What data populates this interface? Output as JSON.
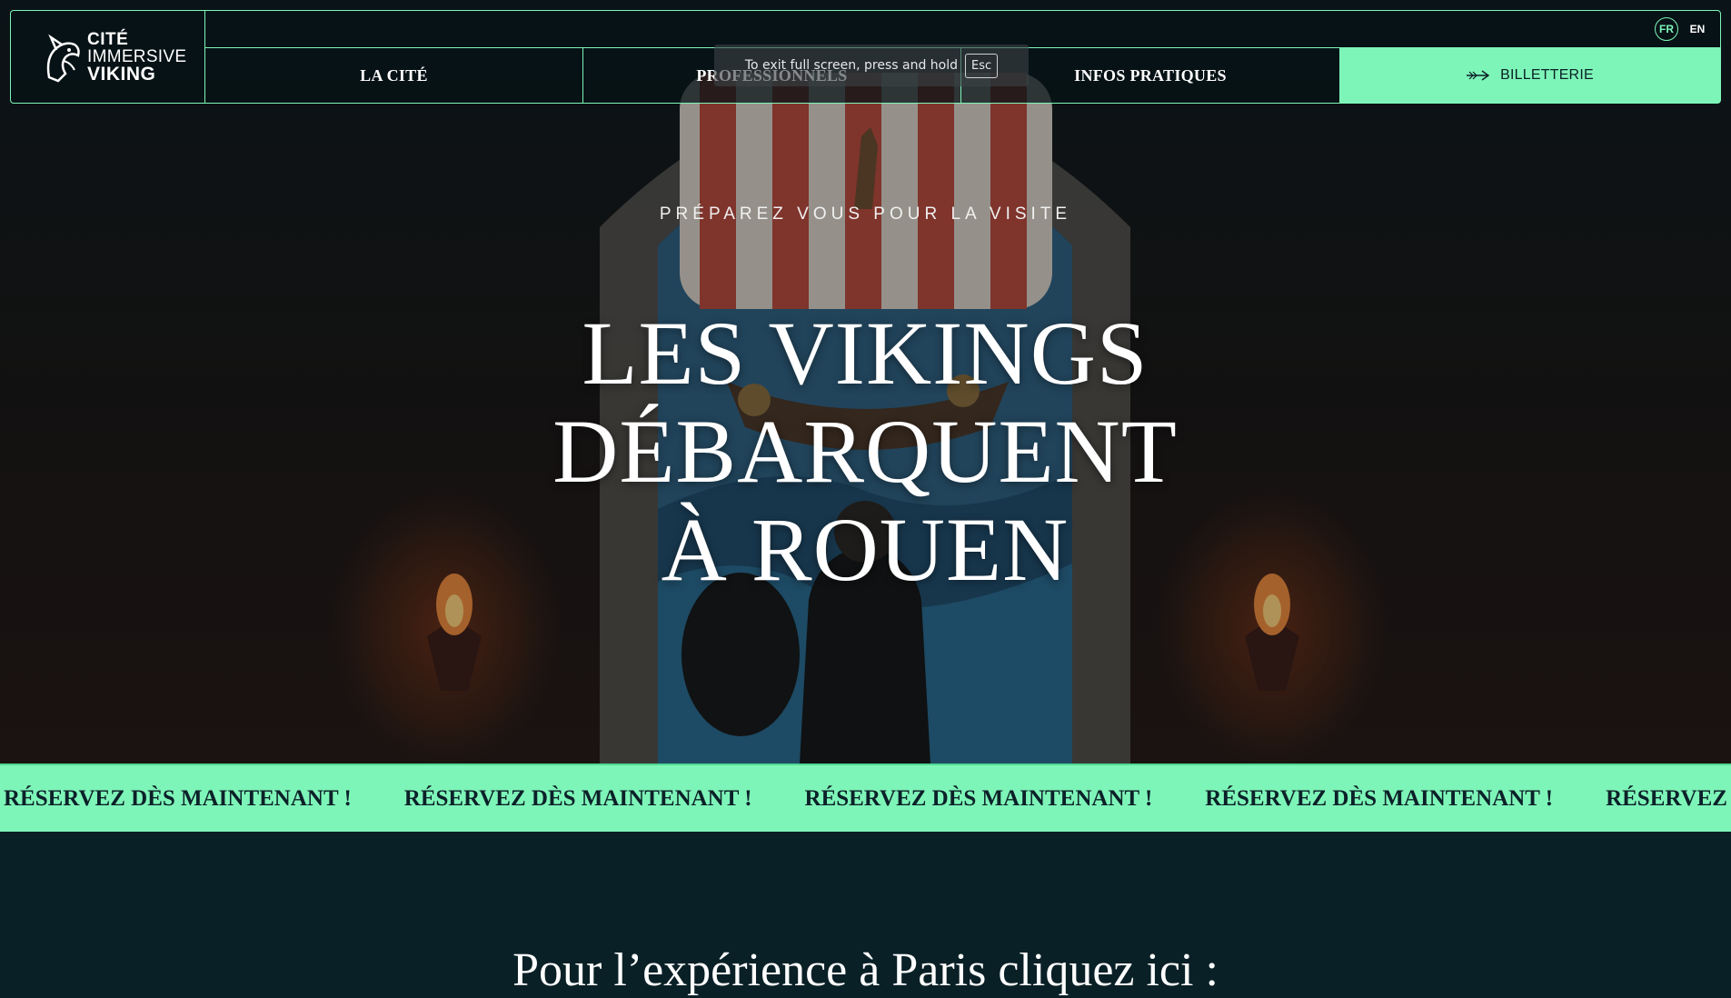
{
  "logo": {
    "line1": "CITÉ",
    "line2": "IMMERSIVE",
    "line3": "VIKING"
  },
  "languages": [
    {
      "label": "FR",
      "active": true
    },
    {
      "label": "EN",
      "active": false
    }
  ],
  "nav": {
    "items": [
      {
        "label": "LA CITÉ"
      },
      {
        "label": "PROFESSIONNELS"
      },
      {
        "label": "INFOS PRATIQUES"
      }
    ],
    "ticket_label": "BILLETTERIE"
  },
  "fullscreen_notice": {
    "text": "To exit full screen, press and hold",
    "key": "Esc"
  },
  "hero": {
    "kicker": "PRÉPAREZ VOUS POUR LA VISITE",
    "title_lines": [
      "LES VIKINGS",
      "DÉBARQUENT",
      "À ROUEN"
    ]
  },
  "marquee": {
    "items": [
      "RÉSERVEZ DÈS MAINTENANT !",
      "RÉSERVEZ DÈS MAINTENANT !",
      "RÉSERVEZ DÈS MAINTENANT !",
      "RÉSERVEZ DÈS MAINTENANT !",
      "RÉSERVEZ DÈS MAINTENANT !"
    ]
  },
  "paris_heading": "Pour l’expérience à Paris cliquez ici :",
  "colors": {
    "accent": "#7ef5b8",
    "background": "#0a2027",
    "text": "#ffffff"
  }
}
